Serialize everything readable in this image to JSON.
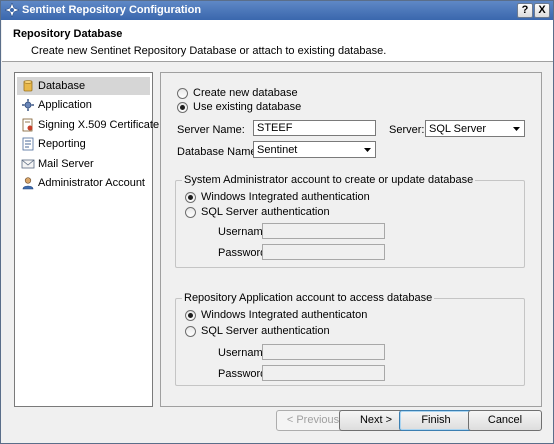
{
  "window": {
    "title": "Sentinet Repository Configuration",
    "help_label": "?",
    "close_label": "X"
  },
  "header": {
    "title": "Repository Database",
    "subtitle": "Create new Sentinet Repository Database or attach to existing database."
  },
  "sidebar": {
    "items": [
      {
        "label": "Database",
        "icon": "database-icon",
        "selected": true
      },
      {
        "label": "Application",
        "icon": "application-icon",
        "selected": false
      },
      {
        "label": "Signing X.509 Certificate",
        "icon": "certificate-icon",
        "selected": false
      },
      {
        "label": "Reporting",
        "icon": "reporting-icon",
        "selected": false
      },
      {
        "label": "Mail Server",
        "icon": "mail-icon",
        "selected": false
      },
      {
        "label": "Administrator Account",
        "icon": "user-icon",
        "selected": false
      }
    ]
  },
  "database_mode": {
    "create_label": "Create new database",
    "existing_label": "Use existing database",
    "selected": "existing"
  },
  "server": {
    "name_label": "Server Name:",
    "name_value": "STEEF",
    "type_label": "Server:",
    "type_value": "SQL Server"
  },
  "database": {
    "name_label": "Database Name:",
    "name_value": "Sentinet"
  },
  "sysadmin_group": {
    "title": "System Administrator account to create or update database",
    "windows_label": "Windows Integrated authentication",
    "sql_label": "SQL Server authentication",
    "selected": "windows",
    "username_label": "Username:",
    "username_value": "",
    "password_label": "Password:",
    "password_value": ""
  },
  "app_group": {
    "title": "Repository Application account to access database",
    "windows_label": "Windows Integrated authenticaton",
    "sql_label": "SQL Server authentication",
    "selected": "windows",
    "username_label": "Username:",
    "username_value": "",
    "password_label": "Password:",
    "password_value": ""
  },
  "footer": {
    "previous_label": "< Previous",
    "next_label": "Next >",
    "finish_label": "Finish",
    "cancel_label": "Cancel"
  },
  "colors": {
    "titlebar": "#3a67ad",
    "selection": "#d6d6d6"
  }
}
